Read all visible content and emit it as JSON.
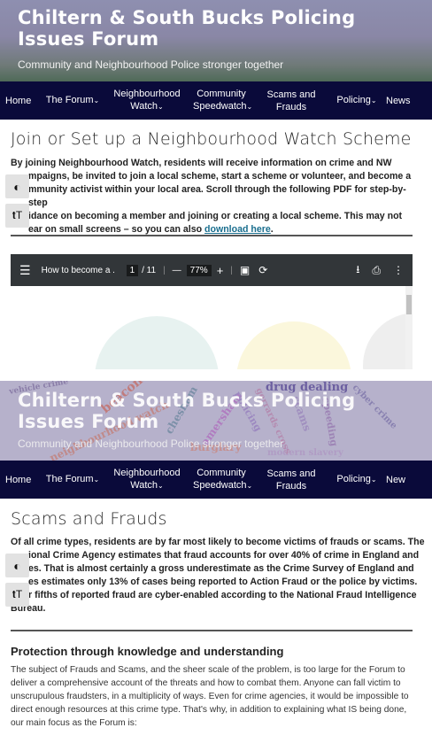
{
  "site": {
    "title": "Chiltern & South Bucks Policing Issues Forum",
    "tagline": "Community and Neighbourhood Police stronger together"
  },
  "nav": [
    {
      "label": "Home",
      "has_dropdown": false
    },
    {
      "label": "The Forum",
      "has_dropdown": true
    },
    {
      "label": "Neighbourhood",
      "label2": "Watch",
      "has_dropdown": true
    },
    {
      "label": "Community",
      "label2": "Speedwatch",
      "has_dropdown": true
    },
    {
      "label": "Scams and",
      "label2": "Frauds",
      "has_dropdown": false
    },
    {
      "label": "Policing",
      "has_dropdown": true
    },
    {
      "label": "News",
      "has_dropdown": false
    }
  ],
  "nav2_last_label": "New",
  "accessibility": {
    "contrast_icon": "contrast-icon",
    "text_size_icon": "text-size-icon"
  },
  "section1": {
    "heading": "Join or Set up a Neighbourhood Watch Scheme",
    "lines": [
      "By joining Neighbourhood Watch, residents will receive information on crime and NW",
      "mpaigns, be invited to join a local scheme, start a scheme or volunteer, and become a",
      "mmunity activist within your local area. Scroll through the following PDF for step-by-step",
      "idance on becoming a member and joining or creating a local scheme. This may not",
      "ear on small screens – so you can also "
    ],
    "link_text": "download here",
    "link_suffix": "."
  },
  "pdf": {
    "title": "How to become a ...",
    "page_current": "1",
    "page_total": "/ 11",
    "zoom": "77%",
    "menu_icon": "menu-icon",
    "zoom_out": "—",
    "zoom_in": "+"
  },
  "word_cloud": [
    "vehicle crime",
    "drug dealing",
    "beacon",
    "chesham",
    "amersham",
    "burglary",
    "modern slavery",
    "cyber crime",
    "scams",
    "speeding",
    "neighbourhood watch",
    "policing",
    "gerrards cross"
  ],
  "section2": {
    "heading": "Scams and Frauds",
    "lines": [
      "Of all crime types, residents are by far most likely to become victims of frauds or scams. The",
      "ional Crime Agency estimates that fraud accounts for over 40% of crime in England and",
      "es. That is almost certainly a gross underestimate as the Crime Survey of England and",
      "es estimates only 13% of cases being reported to Action Fraud or the police by victims.",
      "r fifths of reported fraud are cyber-enabled according to the National Fraud Intelligence",
      "Bureau."
    ],
    "subheading": "Protection through knowledge and understanding",
    "body": [
      "The subject of Frauds and Scams, and the sheer scale of the problem, is too large for the Forum to",
      "deliver a comprehensive account of the threats and how to combat them. Anyone can fall victim to",
      "unscrupulous fraudsters, in a multiplicity of ways. Even for crime agencies, it would be impossible to",
      "direct enough resources at this crime type.  That's why, in addition to explaining what IS being done,",
      "our main focus as the Forum is:"
    ]
  },
  "colors": {
    "nav_bg": "#0a0a3a",
    "link": "#1a6e8e",
    "pdf_toolbar": "#323639"
  }
}
